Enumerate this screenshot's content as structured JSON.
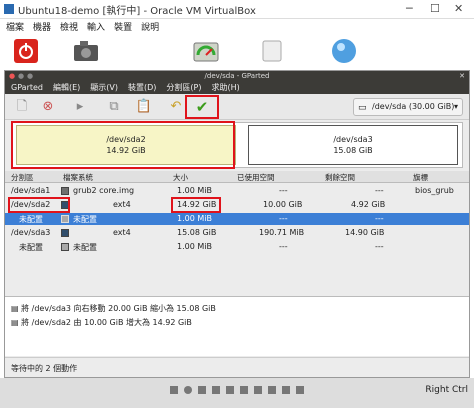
{
  "vb": {
    "title": "Ubuntu18-demo [執行中] - Oracle VM VirtualBox",
    "menu": [
      "檔案",
      "機器",
      "檢視",
      "輸入",
      "裝置",
      "說明"
    ],
    "toolbar_icons": [
      "power-icon",
      "camera-icon",
      "gauge-icon",
      "blank-icon",
      "globe-icon"
    ]
  },
  "guest": {
    "title": "/dev/sda - GParted",
    "menu": [
      "GParted",
      "編輯(E)",
      "顯示(V)",
      "裝置(D)",
      "分割區(P)",
      "求助(H)"
    ],
    "device": "/dev/sda (30.00 GiB)"
  },
  "disk_map": {
    "sda2": {
      "name": "/dev/sda2",
      "size": "14.92 GiB"
    },
    "sda3": {
      "name": "/dev/sda3",
      "size": "15.08 GiB"
    }
  },
  "columns": [
    "分割區",
    "檔案系統",
    "大小",
    "已使用空間",
    "剩餘空間",
    "旗標"
  ],
  "rows": [
    {
      "part": "/dev/sda1",
      "fs": "grub2 core.img",
      "size": "1.00 MiB",
      "used": "---",
      "free": "---",
      "flags": "bios_grub",
      "color": "#6f6f6f"
    },
    {
      "part": "/dev/sda2",
      "fs": "ext4",
      "size": "14.92 GiB",
      "used": "10.00 GiB",
      "free": "4.92 GiB",
      "flags": "",
      "color": "#314e6c"
    },
    {
      "part": "未配置",
      "fs": "未配置",
      "size": "1.00 MiB",
      "used": "---",
      "free": "---",
      "flags": "",
      "color": "#a9a9a9"
    },
    {
      "part": "/dev/sda3",
      "fs": "ext4",
      "size": "15.08 GiB",
      "used": "190.71 MiB",
      "free": "14.90 GiB",
      "flags": "",
      "color": "#314e6c"
    },
    {
      "part": "未配置",
      "fs": "未配置",
      "size": "1.00 MiB",
      "used": "---",
      "free": "---",
      "flags": "",
      "color": "#a9a9a9"
    }
  ],
  "operations": [
    "將 /dev/sda3 向右移動 20.00 GiB 縮小為 15.08 GiB",
    "將 /dev/sda2 由 10.00 GiB 增大為 14.92 GiB"
  ],
  "status": "等待中的 2 個動作",
  "vb_status": {
    "host_key": "Right Ctrl"
  }
}
